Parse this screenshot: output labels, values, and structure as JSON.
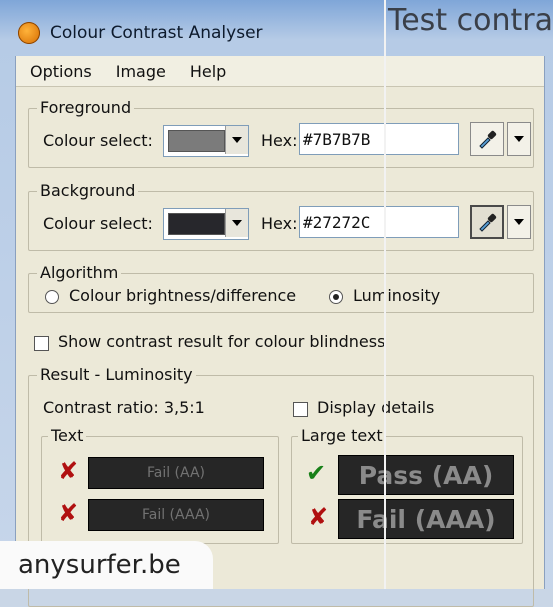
{
  "background_text": "Test contras",
  "window": {
    "title": "Colour Contrast Analyser"
  },
  "menu": [
    "Options",
    "Image",
    "Help"
  ],
  "foreground": {
    "legend": "Foreground",
    "colour_select_label": "Colour select:",
    "swatch_color": "#7B7B7B",
    "hex_label": "Hex:",
    "hex_value": "#7B7B7B"
  },
  "background": {
    "legend": "Background",
    "colour_select_label": "Colour select:",
    "swatch_color": "#27272C",
    "hex_label": "Hex:",
    "hex_value": "#27272C"
  },
  "algorithm": {
    "legend": "Algorithm",
    "options": [
      "Colour brightness/difference",
      "Luminosity"
    ],
    "selected": "Luminosity"
  },
  "colour_blindness_label": "Show contrast result for colour blindness",
  "result": {
    "legend": "Result - Luminosity",
    "contrast_ratio": "Contrast ratio: 3,5:1",
    "display_details_label": "Display details",
    "text_group": {
      "legend": "Text",
      "aa": "Fail (AA)",
      "aaa": "Fail (AAA)"
    },
    "large_text_group": {
      "legend": "Large text",
      "aa": "Pass (AA)",
      "aaa": "Fail (AAA)"
    }
  },
  "watermark": "anysurfer.be",
  "colors": {
    "fail": "#B01010",
    "pass": "#188018"
  }
}
